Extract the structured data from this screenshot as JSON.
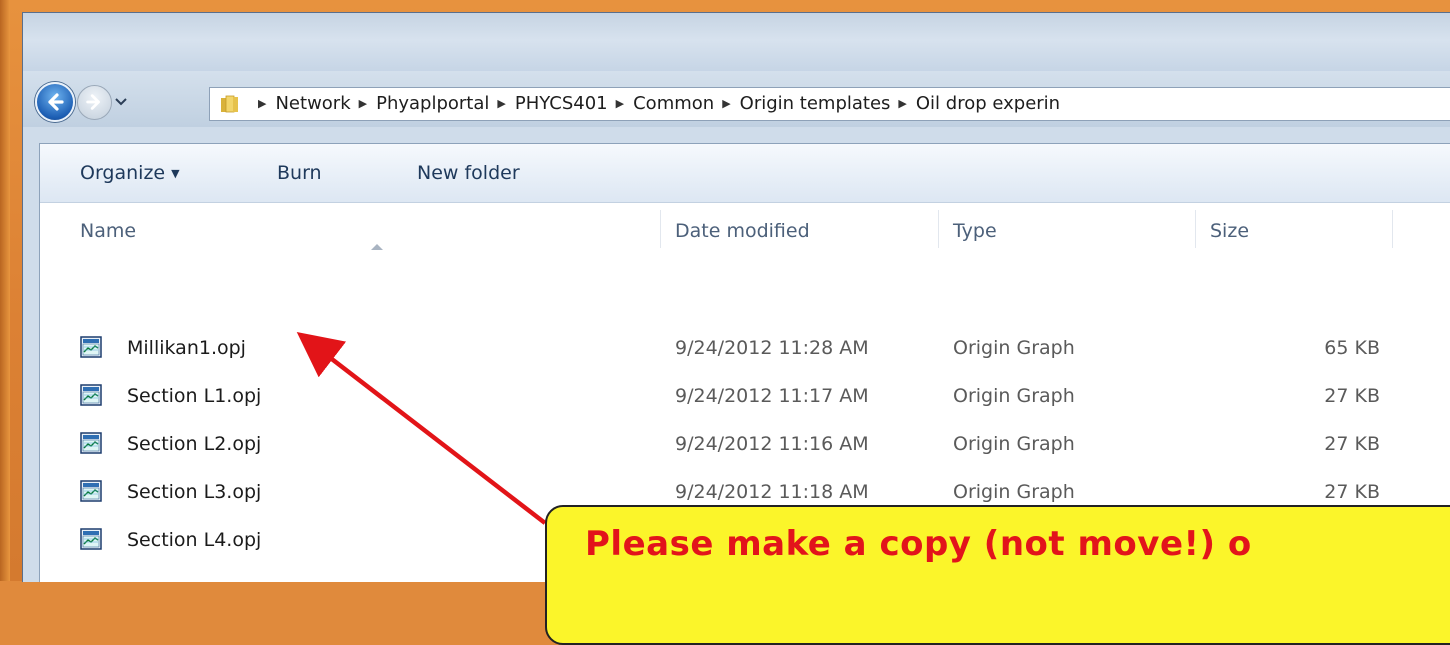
{
  "breadcrumb": [
    "Network",
    "Phyaplportal",
    "PHYCS401",
    "Common",
    "Origin templates",
    "Oil drop experin"
  ],
  "toolbar": {
    "organize": "Organize",
    "burn": "Burn",
    "new_folder": "New folder"
  },
  "columns": {
    "name": "Name",
    "date": "Date modified",
    "type": "Type",
    "size": "Size"
  },
  "files": [
    {
      "name": "Millikan1.opj",
      "date": "9/24/2012 11:28 AM",
      "type": "Origin Graph",
      "size": "65 KB"
    },
    {
      "name": "Section L1.opj",
      "date": "9/24/2012 11:17 AM",
      "type": "Origin Graph",
      "size": "27 KB"
    },
    {
      "name": "Section L2.opj",
      "date": "9/24/2012 11:16 AM",
      "type": "Origin Graph",
      "size": "27 KB"
    },
    {
      "name": "Section L3.opj",
      "date": "9/24/2012 11:18 AM",
      "type": "Origin Graph",
      "size": "27 KB"
    },
    {
      "name": "Section L4.opj",
      "date": "",
      "type": "",
      "size": ""
    }
  ],
  "callout": {
    "text": "Please make a copy (not move!) o"
  },
  "colors": {
    "slide_background": "#e08a3c",
    "callout_fill": "#fbf52a",
    "callout_text": "#e2141b",
    "arrow": "#e21418"
  },
  "icons": {
    "back": "back-arrow-icon",
    "forward": "forward-arrow-icon",
    "folder": "folder-icon",
    "file": "origin-graph-file-icon"
  }
}
